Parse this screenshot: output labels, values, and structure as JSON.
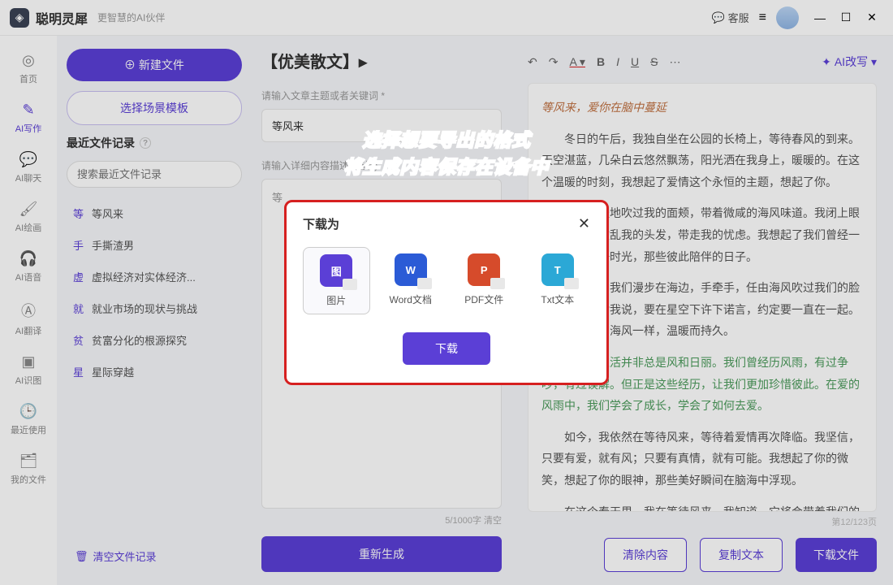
{
  "app": {
    "name": "聪明灵犀",
    "subtitle": "更智慧的AI伙伴"
  },
  "header": {
    "chat": "客服",
    "menu": "≡"
  },
  "sidebar": {
    "items": [
      {
        "icon": "◎",
        "label": "首页"
      },
      {
        "icon": "✎",
        "label": "AI写作"
      },
      {
        "icon": "💬",
        "label": "AI聊天"
      },
      {
        "icon": "🖌",
        "label": "AI绘画"
      },
      {
        "icon": "🎧",
        "label": "AI语音"
      },
      {
        "icon": "Ⓐ",
        "label": "AI翻译"
      },
      {
        "icon": "▣",
        "label": "AI识图"
      },
      {
        "icon": "🕒",
        "label": "最近使用"
      },
      {
        "icon": "🗂",
        "label": "我的文件"
      }
    ]
  },
  "left": {
    "new_file": "⊕ 新建文件",
    "choose_template": "选择场景模板",
    "recent_title": "最近文件记录",
    "help_icon": "?",
    "search_placeholder": "搜索最近文件记录",
    "files": [
      {
        "icon": "等",
        "name": "等风来"
      },
      {
        "icon": "手",
        "name": "手撕渣男"
      },
      {
        "icon": "虚",
        "name": "虚拟经济对实体经济..."
      },
      {
        "icon": "就",
        "name": "就业市场的现状与挑战"
      },
      {
        "icon": "贫",
        "name": "贫富分化的根源探究"
      },
      {
        "icon": "星",
        "name": "星际穿越"
      }
    ],
    "clear": "清空文件记录"
  },
  "mid": {
    "title": "【优美散文】▸",
    "label_keywords": "请输入文章主题或者关键词 *",
    "keyword_value": "等风来",
    "label_detail": "请输入详细内容描述 (选填)",
    "detail_placeholder": "等",
    "char_count": "5/1000字 清空",
    "regenerate": "重新生成"
  },
  "toolbar": {
    "undo": "↶",
    "redo": "↷",
    "color": "A",
    "bold": "B",
    "italic": "I",
    "underline": "U",
    "strike": "S",
    "more": "⋯",
    "ai_rewrite": "AI改写 ▾"
  },
  "content": {
    "title": "等风来，爱你在脑中蔓延",
    "p1": "冬日的午后，我独自坐在公园的长椅上，等待春风的到来。天空湛蓝，几朵白云悠然飘荡，阳光洒在我身上，暖暖的。在这个温暖的时刻，我想起了爱情这个永恒的主题，想起了你。",
    "p2": "风，轻轻地吹过我的面颊，带着微咸的海风味道。我闭上眼睛，任由它吹乱我的头发，带走我的忧虑。我想起了我们曾经一起度过的美好时光，那些彼此陪伴的日子。",
    "p3": "那时候，我们漫步在海边，手牵手，任由海风吹过我们的脸庞。你笑着对我说，要在星空下许下诺言，约定要一直在一起。那些誓言，如海风一样，温暖而持久。",
    "p4": "然而，生活并非总是风和日丽。我们曾经历风雨，有过争吵，有过误解。但正是这些经历，让我们更加珍惜彼此。在爱的风雨中，我们学会了成长，学会了如何去爱。",
    "p5": "如今，我依然在等待风来，等待着爱情再次降临。我坚信，只要有爱，就有风；只要有真情，就有可能。我想起了你的微笑，想起了你的眼神，那些美好瞬间在脑海中浮现。",
    "p6": "在这个春天里，我在等待风来。我知道，它将会带着我们的爱情，重新回到我们的身边。我们将会手牵手，继续前行，走向更加美好的未来。",
    "page_ind": "第12/123页"
  },
  "bottom": {
    "clear": "清除内容",
    "copy": "复制文本",
    "download": "下载文件"
  },
  "instruction": {
    "l1": "选择想要导出的格式",
    "l2": "将生成内容保存在设备中"
  },
  "dialog": {
    "title": "下载为",
    "formats": [
      {
        "label": "图片",
        "badge": "图",
        "color": "#5b3fd6"
      },
      {
        "label": "Word文档",
        "badge": "W",
        "color": "#2b5bd6"
      },
      {
        "label": "PDF文件",
        "badge": "P",
        "color": "#d64b2b"
      },
      {
        "label": "Txt文本",
        "badge": "T",
        "color": "#2ba8d6"
      }
    ],
    "download": "下载"
  }
}
